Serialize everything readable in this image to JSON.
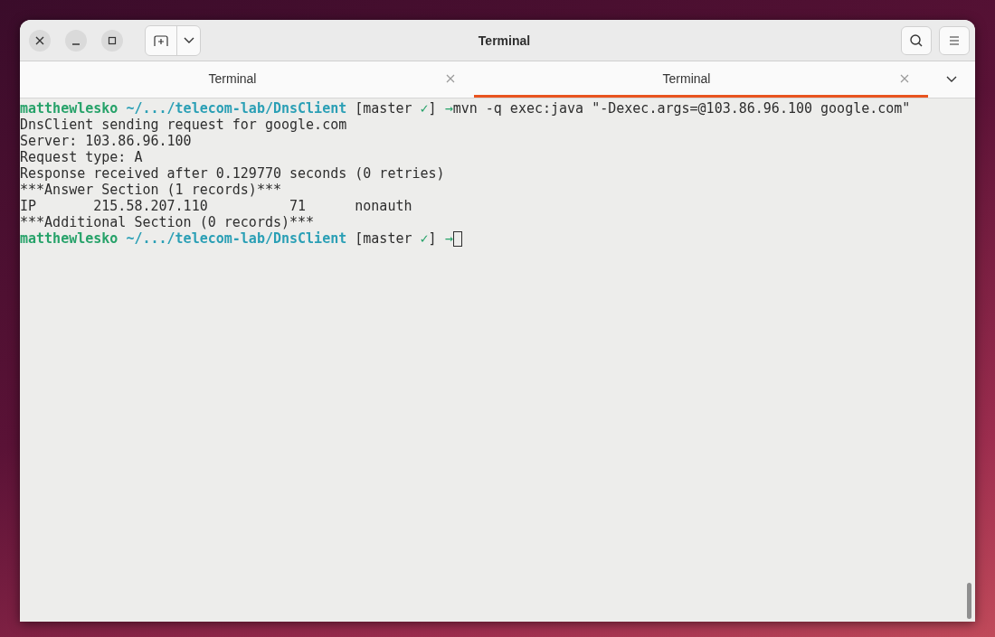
{
  "window": {
    "title": "Terminal"
  },
  "tabs": [
    {
      "label": "Terminal",
      "selected": false
    },
    {
      "label": "Terminal",
      "selected": true
    }
  ],
  "lines": [
    {
      "kind": "prompt",
      "user": "matthewlesko",
      "path": "~/.../telecom-lab/DnsClient",
      "branch_open": "[master",
      "check": "✓",
      "branch_close": "]",
      "arrow": "→",
      "command": "mvn -q exec:java \"-Dexec.args=@103.86.96.100 google.com\""
    },
    {
      "kind": "output",
      "text": "DnsClient sending request for google.com"
    },
    {
      "kind": "output",
      "text": "Server: 103.86.96.100"
    },
    {
      "kind": "output",
      "text": "Request type: A"
    },
    {
      "kind": "output",
      "text": "Response received after 0.129770 seconds (0 retries)"
    },
    {
      "kind": "output",
      "text": "***Answer Section (1 records)***"
    },
    {
      "kind": "output",
      "text": "IP       215.58.207.110          71      nonauth"
    },
    {
      "kind": "output",
      "text": "***Additional Section (0 records)***"
    },
    {
      "kind": "prompt",
      "user": "matthewlesko",
      "path": "~/.../telecom-lab/DnsClient",
      "branch_open": "[master",
      "check": "✓",
      "branch_close": "]",
      "arrow": "→",
      "cursor": true
    }
  ]
}
